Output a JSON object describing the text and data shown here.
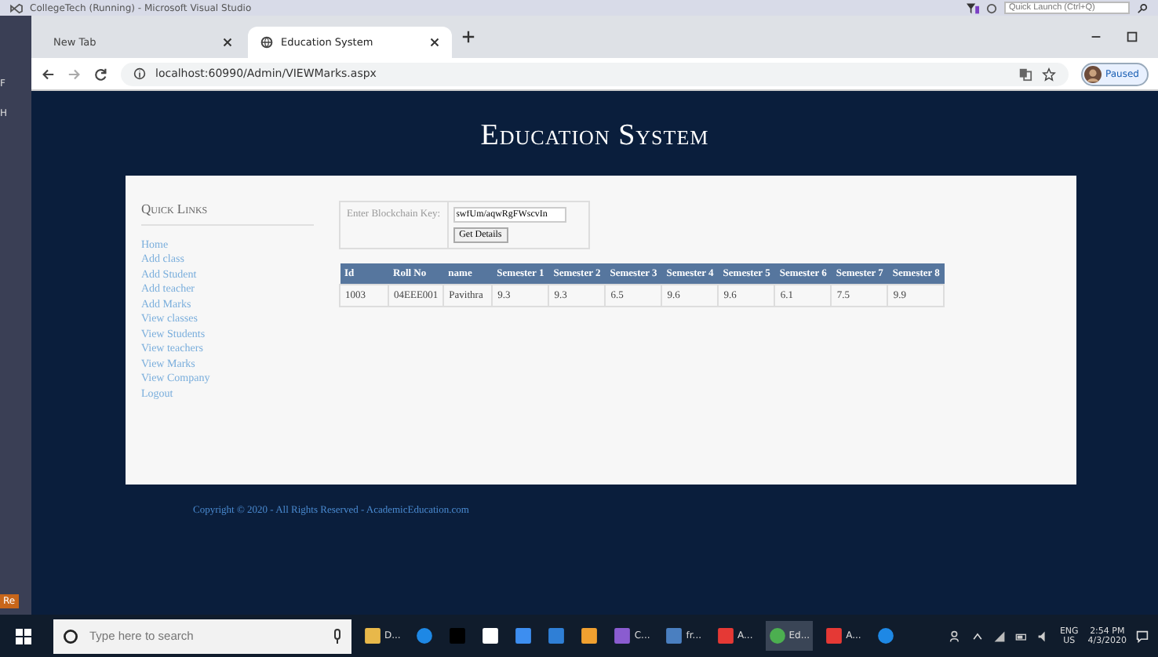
{
  "ide_titlebar": {
    "title": "CollegeTech (Running) - Microsoft Visual Studio",
    "quick_launch": {
      "placeholder": "Quick Launch (Ctrl+Q)"
    },
    "side_letters": [
      "F",
      "H"
    ],
    "side_badge": "Re"
  },
  "browser": {
    "tabs": [
      {
        "label": "New Tab",
        "selected": false
      },
      {
        "label": "Education System",
        "selected": true
      }
    ],
    "address": "localhost:60990/Admin/VIEWMarks.aspx",
    "profile": "Paused"
  },
  "page": {
    "title": "Education System",
    "sidebar": {
      "heading": "Quick Links",
      "links": [
        "Home",
        "Add class",
        "Add Student",
        "Add teacher",
        "Add Marks",
        "View classes",
        "View Students",
        "View teachers",
        "View Marks",
        "View Company",
        "Logout"
      ]
    },
    "form": {
      "label": "Enter Blockchain Key:",
      "value": "swfUm/aqwRgFWscvIn",
      "button": "Get Details"
    },
    "table": {
      "columns": [
        "Id",
        "Roll No",
        "name",
        "Semester 1",
        "Semester 2",
        "Semester 3",
        "Semester 4",
        "Semester 5",
        "Semester 6",
        "Semester 7",
        "Semester 8"
      ],
      "rows": [
        [
          "1003",
          "04EEE001",
          "Pavithra",
          "9.3",
          "9.3",
          "6.5",
          "9.6",
          "9.6",
          "6.1",
          "7.5",
          "9.9"
        ]
      ]
    },
    "footer": "Copyright © 2020 - All Rights Reserved - AcademicEducation.com"
  },
  "taskbar": {
    "search": {
      "placeholder": "Type here to search"
    },
    "apps": [
      {
        "kind": "folder",
        "label": "D...",
        "selected": false
      },
      {
        "kind": "edge",
        "selected": false
      },
      {
        "kind": "netflix",
        "selected": false
      },
      {
        "kind": "store",
        "selected": false
      },
      {
        "kind": "dropbox",
        "selected": false
      },
      {
        "kind": "mail",
        "selected": false
      },
      {
        "kind": "orange",
        "selected": false
      },
      {
        "kind": "vs",
        "label": "C...",
        "selected": false
      },
      {
        "kind": "doc",
        "label": "fr...",
        "selected": false
      },
      {
        "kind": "red",
        "label": "A...",
        "selected": false
      },
      {
        "kind": "chrome",
        "label": "Ed...",
        "selected": true
      },
      {
        "kind": "red",
        "label": "A...",
        "selected": false
      },
      {
        "kind": "help",
        "selected": false
      }
    ],
    "language": [
      "ENG",
      "US"
    ],
    "time": "2:54 PM",
    "date": "4/3/2020"
  }
}
